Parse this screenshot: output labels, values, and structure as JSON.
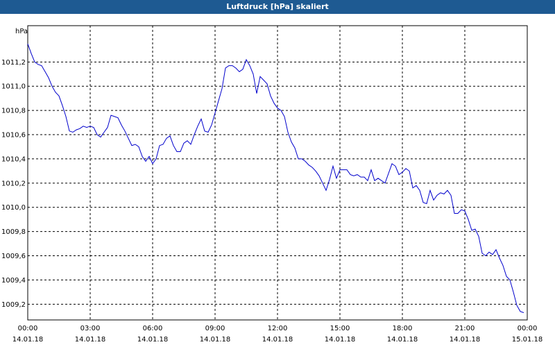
{
  "window": {
    "title": "Luftdruck [hPa] skaliert"
  },
  "chart_data": {
    "type": "line",
    "title": "Luftdruck [hPa] skaliert",
    "ylabel": "hPa",
    "ylim": [
      1009.07,
      1011.5
    ],
    "y_ticks": [
      "1011,2",
      "1011,0",
      "1010,8",
      "1010,6",
      "1010,4",
      "1010,2",
      "1010,0",
      "1009,8",
      "1009,6",
      "1009,4",
      "1009,2"
    ],
    "x_ticks": [
      {
        "time": "00:00",
        "date": "14.01.18"
      },
      {
        "time": "03:00",
        "date": "14.01.18"
      },
      {
        "time": "06:00",
        "date": "14.01.18"
      },
      {
        "time": "09:00",
        "date": "14.01.18"
      },
      {
        "time": "12:00",
        "date": "14.01.18"
      },
      {
        "time": "15:00",
        "date": "14.01.18"
      },
      {
        "time": "18:00",
        "date": "14.01.18"
      },
      {
        "time": "21:00",
        "date": "14.01.18"
      },
      {
        "time": "00:00",
        "date": "15.01.18"
      }
    ],
    "xlim": [
      "14.01.18 00:00",
      "15.01.18 00:00"
    ],
    "grid": true,
    "colors": {
      "line": "#0000cc",
      "grid": "#000000",
      "title_bar": "#1e5a92"
    },
    "series": [
      {
        "points": [
          [
            "00:00",
            1011.35
          ],
          [
            "00:10",
            1011.27
          ],
          [
            "00:20",
            1011.2
          ],
          [
            "00:30",
            1011.18
          ],
          [
            "00:40",
            1011.17
          ],
          [
            "00:50",
            1011.12
          ],
          [
            "01:00",
            1011.07
          ],
          [
            "01:10",
            1011.0
          ],
          [
            "01:20",
            1010.95
          ],
          [
            "01:30",
            1010.92
          ],
          [
            "01:40",
            1010.84
          ],
          [
            "01:50",
            1010.75
          ],
          [
            "02:00",
            1010.63
          ],
          [
            "02:10",
            1010.62
          ],
          [
            "02:20",
            1010.64
          ],
          [
            "02:30",
            1010.65
          ],
          [
            "02:40",
            1010.67
          ],
          [
            "02:50",
            1010.66
          ],
          [
            "03:00",
            1010.67
          ],
          [
            "03:10",
            1010.66
          ],
          [
            "03:20",
            1010.6
          ],
          [
            "03:30",
            1010.58
          ],
          [
            "03:40",
            1010.62
          ],
          [
            "03:50",
            1010.66
          ],
          [
            "04:00",
            1010.76
          ],
          [
            "04:10",
            1010.75
          ],
          [
            "04:20",
            1010.74
          ],
          [
            "04:30",
            1010.68
          ],
          [
            "04:40",
            1010.63
          ],
          [
            "04:50",
            1010.57
          ],
          [
            "05:00",
            1010.51
          ],
          [
            "05:10",
            1010.52
          ],
          [
            "05:20",
            1010.5
          ],
          [
            "05:30",
            1010.42
          ],
          [
            "05:40",
            1010.38
          ],
          [
            "05:50",
            1010.42
          ],
          [
            "06:00",
            1010.36
          ],
          [
            "06:10",
            1010.4
          ],
          [
            "06:20",
            1010.51
          ],
          [
            "06:30",
            1010.52
          ],
          [
            "06:40",
            1010.57
          ],
          [
            "06:50",
            1010.59
          ],
          [
            "07:00",
            1010.51
          ],
          [
            "07:10",
            1010.46
          ],
          [
            "07:20",
            1010.46
          ],
          [
            "07:30",
            1010.53
          ],
          [
            "07:40",
            1010.55
          ],
          [
            "07:50",
            1010.52
          ],
          [
            "08:00",
            1010.6
          ],
          [
            "08:10",
            1010.67
          ],
          [
            "08:20",
            1010.73
          ],
          [
            "08:30",
            1010.63
          ],
          [
            "08:40",
            1010.62
          ],
          [
            "08:50",
            1010.68
          ],
          [
            "09:00",
            1010.78
          ],
          [
            "09:10",
            1010.88
          ],
          [
            "09:20",
            1010.98
          ],
          [
            "09:30",
            1011.15
          ],
          [
            "09:40",
            1011.17
          ],
          [
            "09:50",
            1011.17
          ],
          [
            "10:00",
            1011.15
          ],
          [
            "10:10",
            1011.12
          ],
          [
            "10:20",
            1011.14
          ],
          [
            "10:30",
            1011.22
          ],
          [
            "10:40",
            1011.17
          ],
          [
            "10:50",
            1011.1
          ],
          [
            "11:00",
            1010.94
          ],
          [
            "11:10",
            1011.08
          ],
          [
            "11:20",
            1011.05
          ],
          [
            "11:30",
            1011.02
          ],
          [
            "11:40",
            1010.92
          ],
          [
            "11:50",
            1010.86
          ],
          [
            "12:00",
            1010.82
          ],
          [
            "12:10",
            1010.8
          ],
          [
            "12:20",
            1010.75
          ],
          [
            "12:30",
            1010.62
          ],
          [
            "12:40",
            1010.54
          ],
          [
            "12:50",
            1010.49
          ],
          [
            "13:00",
            1010.4
          ],
          [
            "13:10",
            1010.4
          ],
          [
            "13:20",
            1010.38
          ],
          [
            "13:30",
            1010.35
          ],
          [
            "13:40",
            1010.33
          ],
          [
            "13:50",
            1010.3
          ],
          [
            "14:00",
            1010.26
          ],
          [
            "14:10",
            1010.2
          ],
          [
            "14:20",
            1010.14
          ],
          [
            "14:30",
            1010.23
          ],
          [
            "14:40",
            1010.34
          ],
          [
            "14:50",
            1010.24
          ],
          [
            "15:00",
            1010.31
          ],
          [
            "15:10",
            1010.31
          ],
          [
            "15:20",
            1010.31
          ],
          [
            "15:30",
            1010.27
          ],
          [
            "15:40",
            1010.26
          ],
          [
            "15:50",
            1010.27
          ],
          [
            "16:00",
            1010.25
          ],
          [
            "16:10",
            1010.25
          ],
          [
            "16:20",
            1010.22
          ],
          [
            "16:30",
            1010.31
          ],
          [
            "16:40",
            1010.22
          ],
          [
            "16:50",
            1010.24
          ],
          [
            "17:00",
            1010.22
          ],
          [
            "17:10",
            1010.2
          ],
          [
            "17:20",
            1010.28
          ],
          [
            "17:30",
            1010.36
          ],
          [
            "17:40",
            1010.34
          ],
          [
            "17:50",
            1010.27
          ],
          [
            "18:00",
            1010.29
          ],
          [
            "18:10",
            1010.32
          ],
          [
            "18:20",
            1010.3
          ],
          [
            "18:30",
            1010.16
          ],
          [
            "18:40",
            1010.18
          ],
          [
            "18:50",
            1010.14
          ],
          [
            "19:00",
            1010.04
          ],
          [
            "19:10",
            1010.03
          ],
          [
            "19:20",
            1010.14
          ],
          [
            "19:30",
            1010.06
          ],
          [
            "19:40",
            1010.1
          ],
          [
            "19:50",
            1010.12
          ],
          [
            "20:00",
            1010.11
          ],
          [
            "20:10",
            1010.14
          ],
          [
            "20:20",
            1010.1
          ],
          [
            "20:30",
            1009.95
          ],
          [
            "20:40",
            1009.95
          ],
          [
            "20:50",
            1009.98
          ],
          [
            "21:00",
            1009.97
          ],
          [
            "21:10",
            1009.9
          ],
          [
            "21:20",
            1009.81
          ],
          [
            "21:30",
            1009.82
          ],
          [
            "21:40",
            1009.76
          ],
          [
            "21:50",
            1009.62
          ],
          [
            "22:00",
            1009.6
          ],
          [
            "22:10",
            1009.63
          ],
          [
            "22:20",
            1009.61
          ],
          [
            "22:30",
            1009.65
          ],
          [
            "22:40",
            1009.58
          ],
          [
            "22:50",
            1009.52
          ],
          [
            "23:00",
            1009.43
          ],
          [
            "23:10",
            1009.4
          ],
          [
            "23:20",
            1009.3
          ],
          [
            "23:30",
            1009.19
          ],
          [
            "23:40",
            1009.14
          ],
          [
            "23:50",
            1009.13
          ]
        ]
      }
    ]
  }
}
